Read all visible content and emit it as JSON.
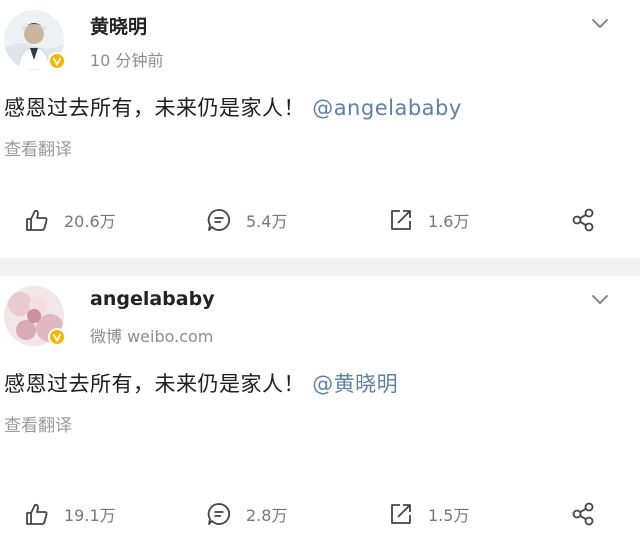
{
  "posts": [
    {
      "author": "黄晓明",
      "meta": "10 分钟前",
      "text": "感恩过去所有，未来仍是家人！",
      "mention": "@angelababy",
      "translate": "查看翻译",
      "likes": "20.6万",
      "comments": "5.4万",
      "reposts": "1.6万"
    },
    {
      "author": "angelababy",
      "meta": "微博 weibo.com",
      "text": "感恩过去所有，未来仍是家人！",
      "mention": "@黄晓明",
      "translate": "查看翻译",
      "likes": "19.1万",
      "comments": "2.8万",
      "reposts": "1.5万"
    }
  ],
  "colors": {
    "mention": "#5e7fa8",
    "verified_badge": "#f7b500",
    "meta_text": "#8c8c8c",
    "divider": "#f2f2f2"
  },
  "icons": [
    "chevron-down-icon",
    "like-icon",
    "comment-icon",
    "repost-icon",
    "share-icon",
    "verified-badge-icon"
  ]
}
